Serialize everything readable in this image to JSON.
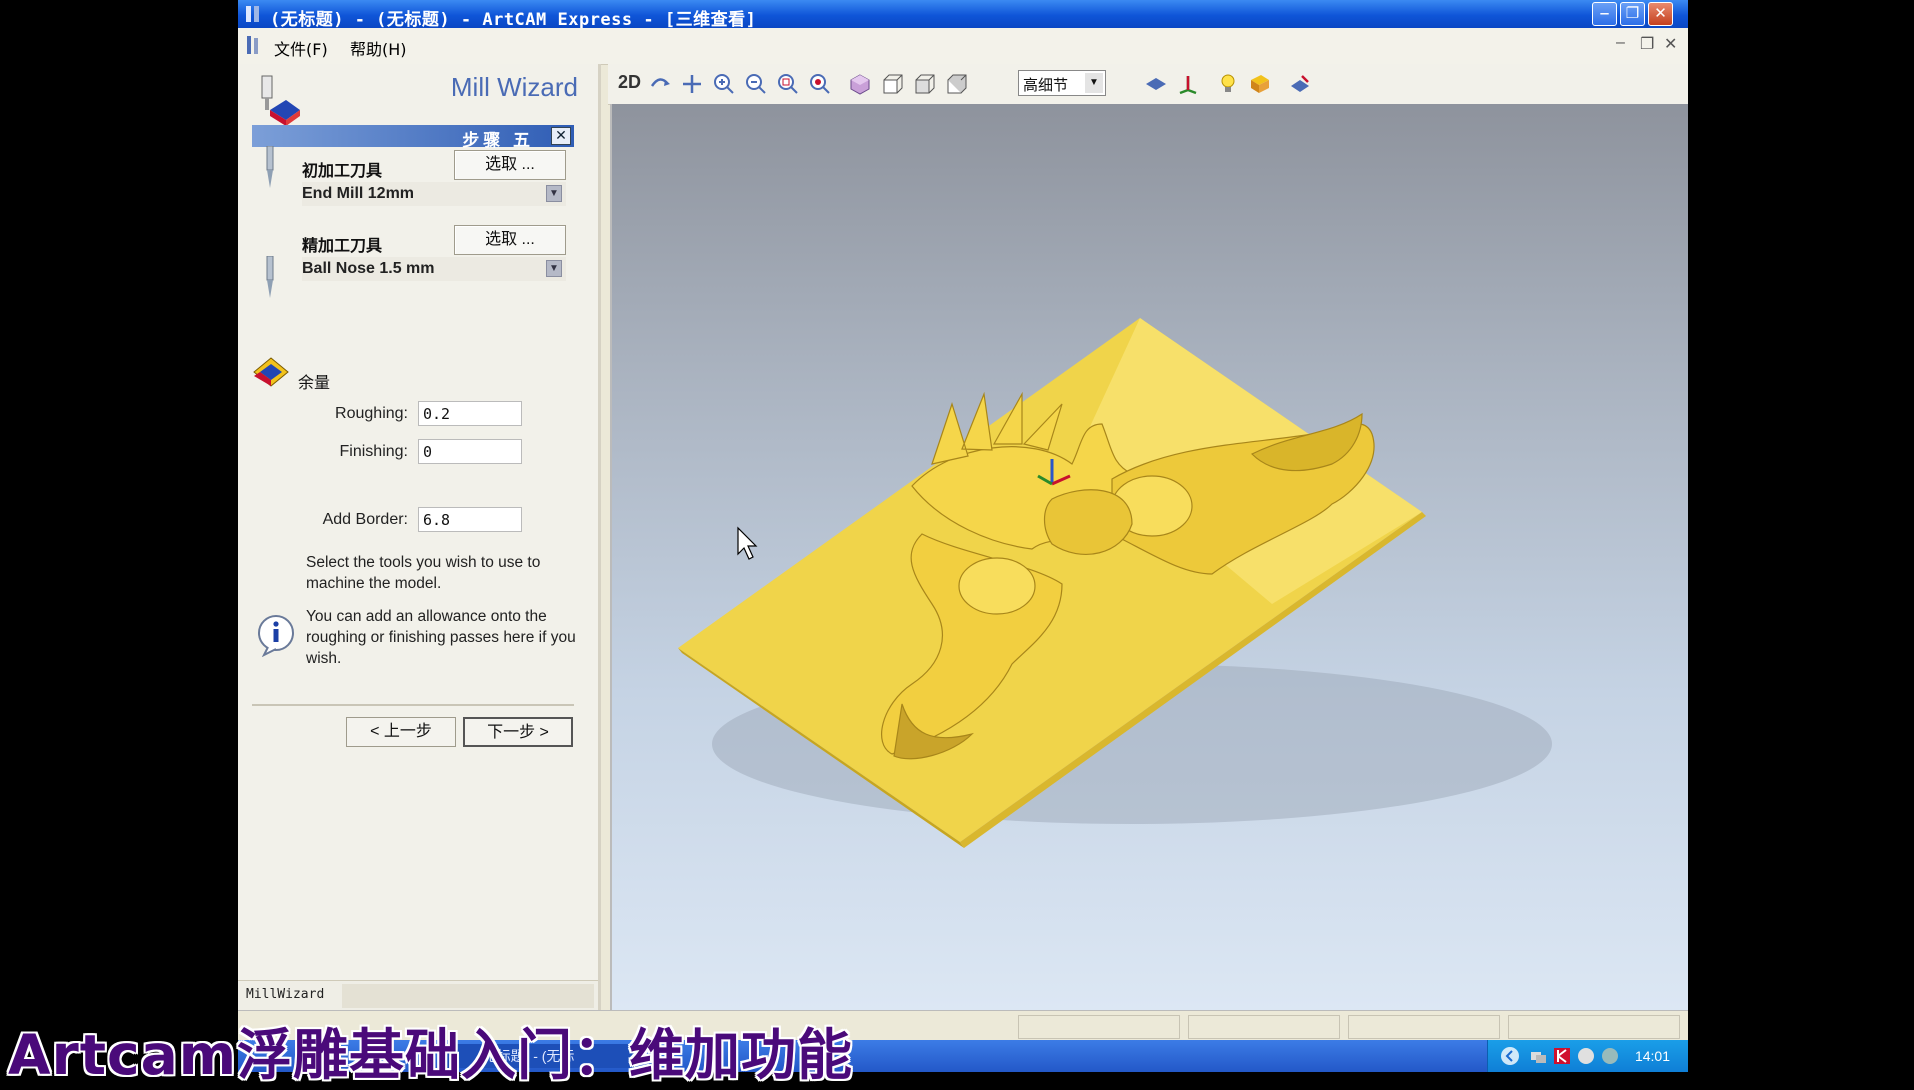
{
  "window": {
    "title": "(无标题) - (无标题) - ArtCAM Express - [三维查看]",
    "minimize_glyph": "‒",
    "maximize_glyph": "❐",
    "close_glyph": "✕"
  },
  "menu": {
    "file": "文件(F)",
    "help": "帮助(H)",
    "mdi_min": "–",
    "mdi_restore": "❐",
    "mdi_close": "✕"
  },
  "wizard": {
    "title": "Mill Wizard",
    "step": "步骤 五",
    "step_close": "✕",
    "roughing_tool_label": "初加工刀具",
    "roughing_tool_select": "选取 ...",
    "roughing_tool_value": "End Mill 12mm",
    "finishing_tool_label": "精加工刀具",
    "finishing_tool_select": "选取 ...",
    "finishing_tool_value": "Ball Nose 1.5 mm",
    "allowance_label": "余量",
    "roughing_label": "Roughing:",
    "roughing_value": "0.2",
    "finishing_label": "Finishing:",
    "finishing_value": "0",
    "border_label": "Add Border:",
    "border_value": "6.8",
    "info_text_1": "Select the tools you wish to use to machine the model.",
    "info_text_2": "You can add an allowance onto the roughing or finishing passes here if you wish.",
    "prev_button": "< 上一步",
    "next_button": "下一步 >",
    "status_label": "MillWizard"
  },
  "toolbar": {
    "two_d": "2D",
    "detail_level": "高细节",
    "icons": [
      "rotate-icon",
      "pan-icon",
      "zoom-in-icon",
      "zoom-out-icon",
      "zoom-box-icon",
      "zoom-fit-icon",
      "iso-view-icon",
      "front-view-icon",
      "side-view-icon",
      "top-view-icon",
      "flat-shade-icon",
      "axis-icon",
      "light-icon",
      "material-icon",
      "render-icon"
    ]
  },
  "taskbar": {
    "item_text": "(无标题) - (无标",
    "clock": "14:01"
  },
  "caption": "Artcam浮雕基础入门：维加功能",
  "colors": {
    "relief": "#f5d64a",
    "relief_shadow": "#c7a620",
    "title_bar": "#0f55d8",
    "wizard_title": "#4a6bb5"
  }
}
